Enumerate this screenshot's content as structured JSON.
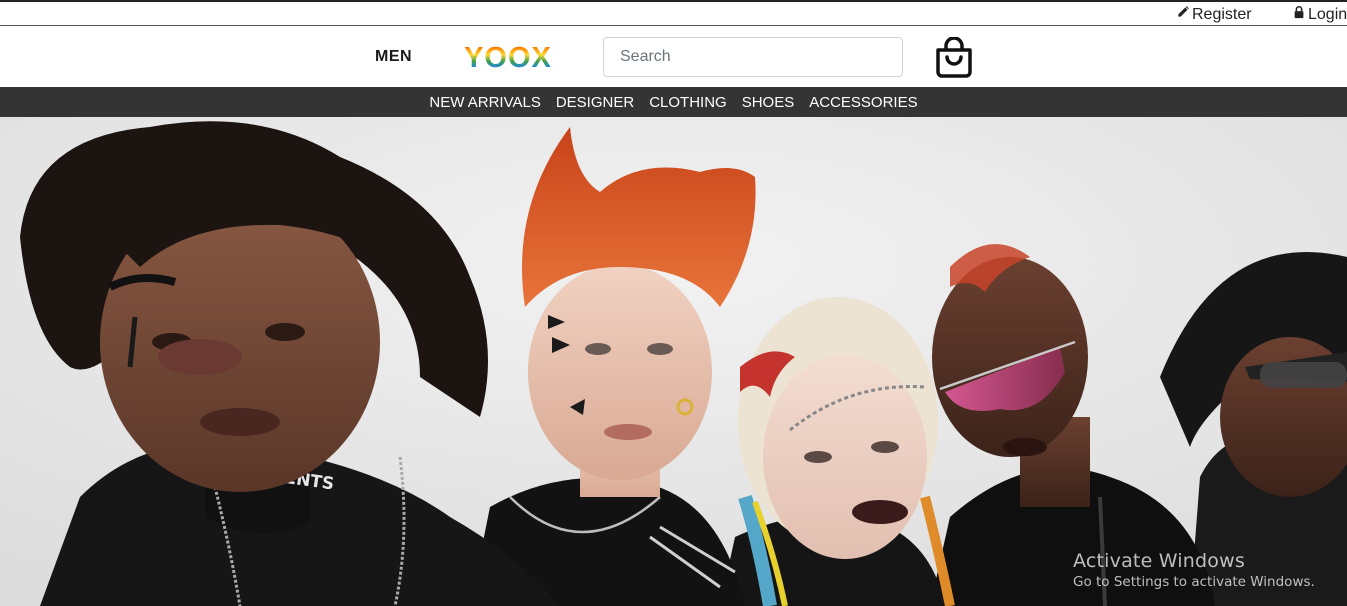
{
  "utility": {
    "register_label": "Register",
    "login_label": "Login"
  },
  "header": {
    "men_label": "MEN",
    "logo_text": "YOOX",
    "search_placeholder": "Search"
  },
  "nav": {
    "items": [
      "NEW ARRIVALS",
      "DESIGNER",
      "CLOTHING",
      "SHOES",
      "ACCESSORIES"
    ]
  },
  "hero": {
    "shirt_print": "VETEMENTS"
  },
  "watermark": {
    "title": "Activate Windows",
    "subtitle": "Go to Settings to activate Windows."
  },
  "colors": {
    "nav_bg": "#343434",
    "logo_gradient": [
      "#e53935",
      "#fb8c00",
      "#fdd835",
      "#43a047",
      "#1e88e5",
      "#8e24aa"
    ]
  }
}
